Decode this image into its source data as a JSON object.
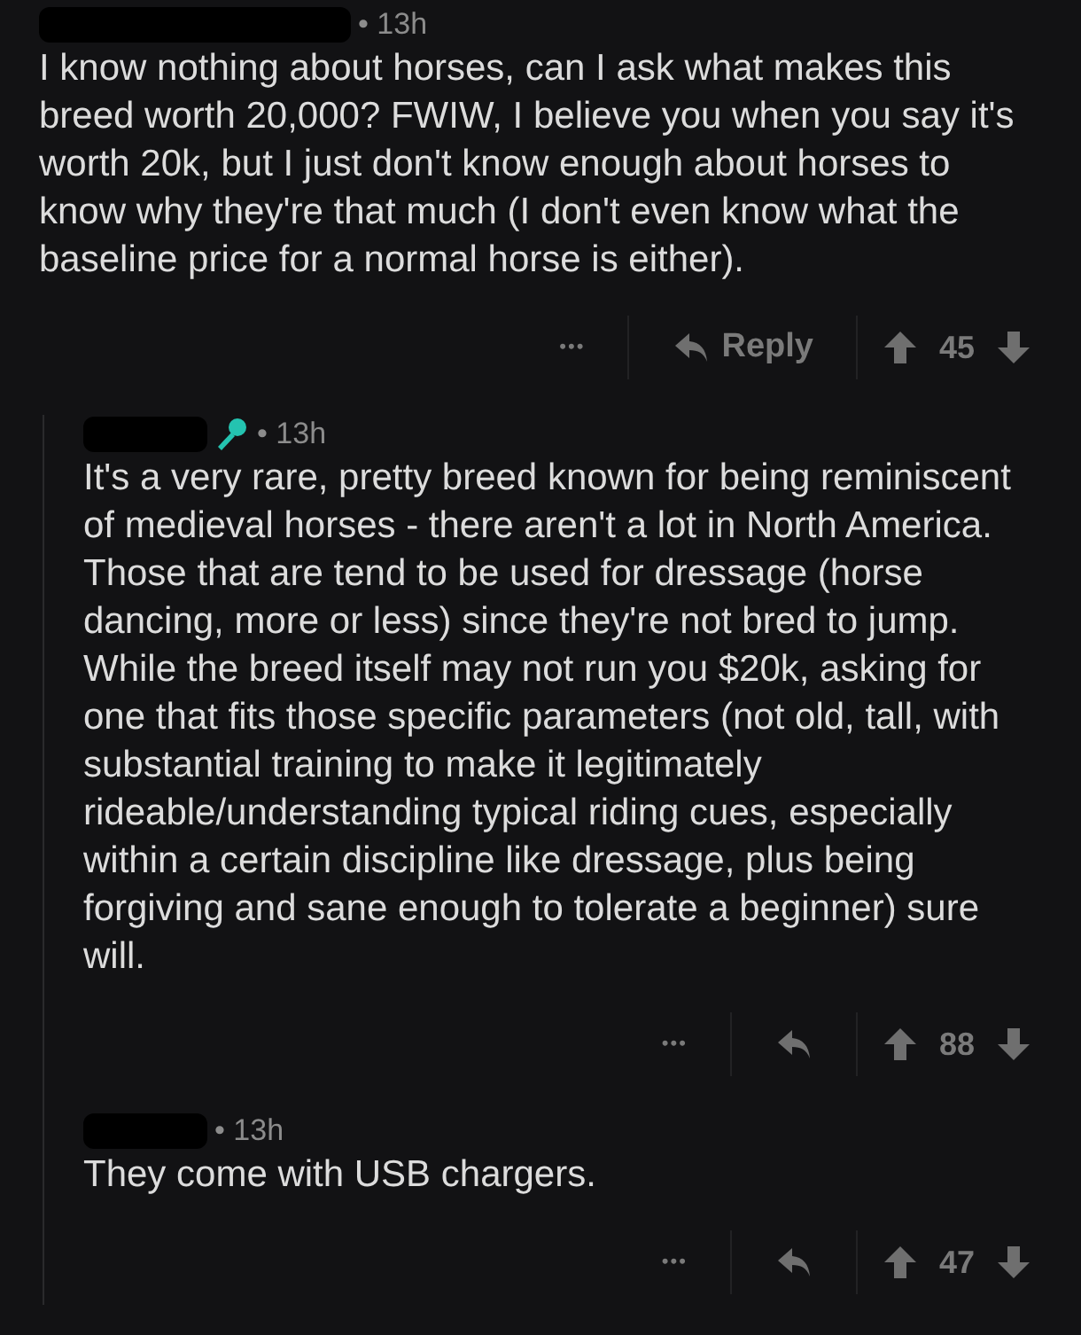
{
  "comments": [
    {
      "time": "• 13h",
      "flair": false,
      "body": "I know nothing about horses, can I ask what makes this breed worth 20,000? FWIW, I believe you when you say it's worth 20k, but I just don't know enough about horses to know why they're that much (I don't even know what the baseline price for a normal horse is either).",
      "more": "•••",
      "reply_label": "Reply",
      "score": "45",
      "children": [
        {
          "time": "• 13h",
          "flair": true,
          "body": "It's a very rare, pretty breed known for being reminiscent of medieval horses - there aren't a lot in North America. Those that are tend to be used for dressage (horse dancing, more or less) since they're not bred to jump. While the breed itself may not run you $20k, asking for one that fits those specific parameters (not old, tall, with substantial training to make it legitimately rideable/understanding typical riding cues, especially within a certain discipline like dressage, plus being forgiving and sane enough to tolerate a beginner) sure will.",
          "more": "•••",
          "score": "88"
        },
        {
          "time": "• 13h",
          "flair": false,
          "body": "They come with USB chargers.",
          "more": "•••",
          "score": "47"
        }
      ]
    }
  ]
}
